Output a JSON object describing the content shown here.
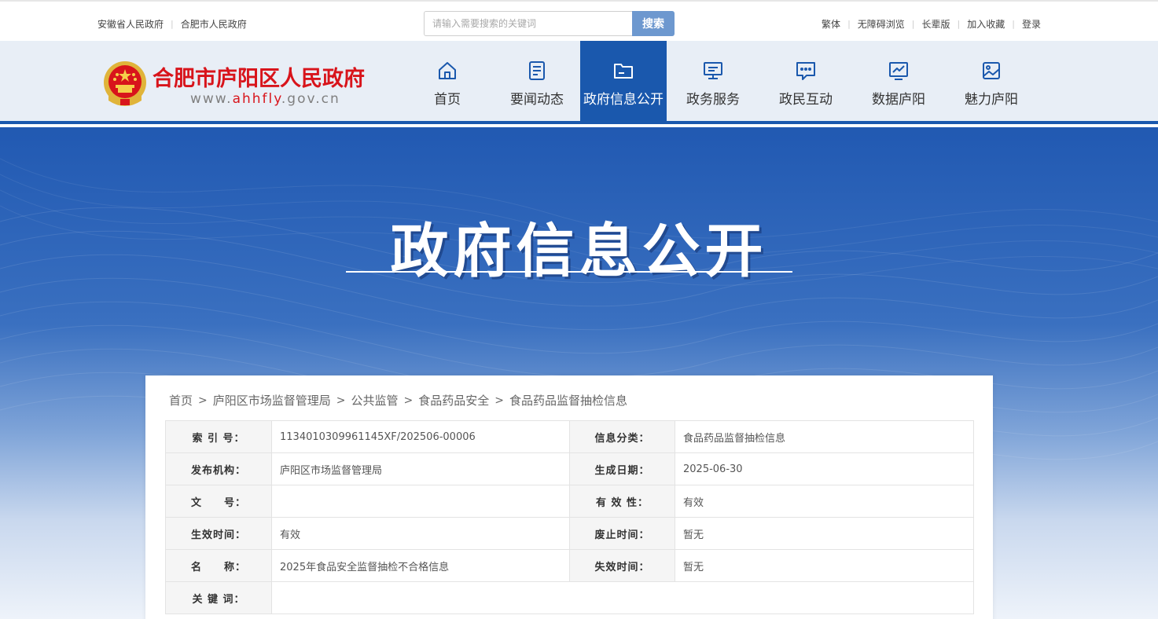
{
  "topbar": {
    "left_links": [
      "安徽省人民政府",
      "合肥市人民政府"
    ],
    "search_placeholder": "请输入需要搜索的关键词",
    "search_button": "搜索",
    "right_links": [
      "繁体",
      "无障碍浏览",
      "长辈版",
      "加入收藏",
      "登录"
    ]
  },
  "header": {
    "site_name": "合肥市庐阳区人民政府",
    "url_prefix": "www.",
    "url_highlight": "ahhfly",
    "url_suffix": ".gov.cn"
  },
  "nav": {
    "items": [
      {
        "label": "首页",
        "icon": "home-icon"
      },
      {
        "label": "要闻动态",
        "icon": "news-icon"
      },
      {
        "label": "政府信息公开",
        "icon": "folder-icon"
      },
      {
        "label": "政务服务",
        "icon": "monitor-icon"
      },
      {
        "label": "政民互动",
        "icon": "chat-icon"
      },
      {
        "label": "数据庐阳",
        "icon": "chart-icon"
      },
      {
        "label": "魅力庐阳",
        "icon": "image-icon"
      }
    ],
    "active_index": 2
  },
  "banner": {
    "title": "政府信息公开"
  },
  "breadcrumb": [
    "首页",
    "庐阳区市场监督管理局",
    "公共监管",
    "食品药品安全",
    "食品药品监督抽检信息"
  ],
  "info_table": {
    "rows": [
      [
        {
          "label": "索 引 号：",
          "value": "1134010309961145XF/202506-00006"
        },
        {
          "label": "信息分类：",
          "value": "食品药品监督抽检信息"
        }
      ],
      [
        {
          "label": "发布机构：",
          "value": "庐阳区市场监督管理局"
        },
        {
          "label": "生成日期：",
          "value": "2025-06-30"
        }
      ],
      [
        {
          "label": "文　　号：",
          "value": ""
        },
        {
          "label": "有 效 性：",
          "value": "有效"
        }
      ],
      [
        {
          "label": "生效时间：",
          "value": "有效"
        },
        {
          "label": "废止时间：",
          "value": "暂无"
        }
      ],
      [
        {
          "label": "名　　称：",
          "value": "2025年食品安全监督抽检不合格信息"
        },
        {
          "label": "失效时间：",
          "value": "暂无"
        }
      ]
    ],
    "keywords_label": "关 键 词：",
    "keywords_value": ""
  },
  "colors": {
    "brand_red": "#d8141b",
    "nav_blue": "#1a58ad",
    "search_button": "#6d98cf"
  }
}
